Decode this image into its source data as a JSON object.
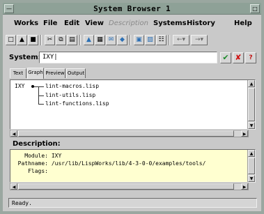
{
  "window": {
    "title": "System Browser 1",
    "left_button": "—",
    "right_button": "□"
  },
  "menu": [
    "Works",
    "File",
    "Edit",
    "View",
    "Description",
    "Systems",
    "History",
    "Help"
  ],
  "toolbar": {
    "icons": [
      "new-icon",
      "open-icon",
      "save-icon",
      "cut-icon",
      "copy-icon",
      "paste-icon",
      "compile-icon",
      "load-icon",
      "build-icon",
      "preview-icon",
      "browse-icon",
      "inspect-icon",
      "back-icon",
      "forward-icon"
    ]
  },
  "system": {
    "label": "System:",
    "value": "IXY"
  },
  "tabs": [
    "Text",
    "Graph",
    "Preview",
    "Output"
  ],
  "tree": {
    "root": "IXY",
    "children": [
      "lint-macros.lisp",
      "lint-utils.lisp",
      "lint-functions.lisp"
    ]
  },
  "description": {
    "label": "Description:",
    "rows": [
      {
        "key": "Module:",
        "value": "IXY"
      },
      {
        "key": "Pathname:",
        "value": "/usr/lib/LispWorks/lib/4-3-0-0/examples/tools/"
      },
      {
        "key": "Flags:",
        "value": ""
      }
    ]
  },
  "status": {
    "text": "Ready."
  }
}
